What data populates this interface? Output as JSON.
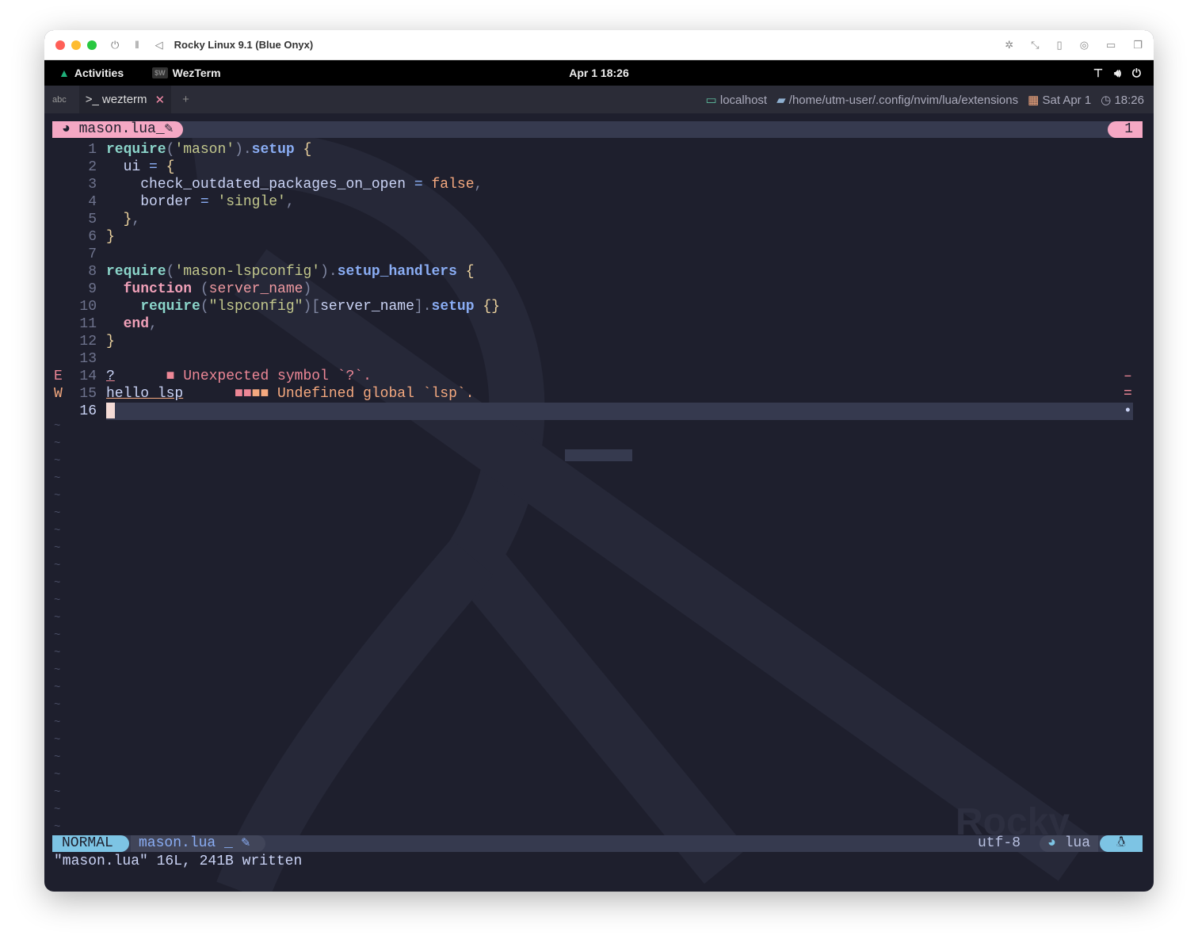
{
  "titlebar": {
    "title": "Rocky Linux 9.1 (Blue Onyx)",
    "icons": [
      "power-icon",
      "pause-icon",
      "back-icon",
      "capture-cursor-icon",
      "resize-icon",
      "usb-icon",
      "cd-icon",
      "shared-folder-icon",
      "windows-icon"
    ]
  },
  "gnome": {
    "activities": "Activities",
    "app": "WezTerm",
    "app_icon": "$W",
    "clock": "Apr 1  18:26"
  },
  "tabbar": {
    "abc": "abc",
    "tab_label": "wezterm",
    "tab_prompt": ">_",
    "host": "localhost",
    "path": "/home/utm-user/.config/nvim/lua/extensions",
    "date": "Sat Apr 1",
    "time": "18:26"
  },
  "tabline": {
    "buffer": "mason.lua_",
    "buffer_number": "1"
  },
  "lines": [
    {
      "n": "1",
      "t": [
        [
          "kw",
          "require"
        ],
        [
          "pun",
          "("
        ],
        [
          "str",
          "'mason'"
        ],
        [
          "pun",
          ")."
        ],
        [
          "fn",
          "setup"
        ],
        [
          "",
          ""
        ],
        [
          "br",
          " {"
        ]
      ]
    },
    {
      "n": "2",
      "t": [
        [
          "",
          "  ui "
        ],
        [
          "op",
          "="
        ],
        [
          "br",
          " {"
        ]
      ]
    },
    {
      "n": "3",
      "t": [
        [
          "",
          "    check_outdated_packages_on_open "
        ],
        [
          "op",
          "="
        ],
        [
          "bool",
          " false"
        ],
        [
          "pun",
          ","
        ]
      ]
    },
    {
      "n": "4",
      "t": [
        [
          "",
          "    border "
        ],
        [
          "op",
          "="
        ],
        [
          "str",
          " 'single'"
        ],
        [
          "pun",
          ","
        ]
      ]
    },
    {
      "n": "5",
      "t": [
        [
          "br",
          "  }"
        ],
        [
          "pun",
          ","
        ]
      ]
    },
    {
      "n": "6",
      "t": [
        [
          "br",
          "}"
        ]
      ]
    },
    {
      "n": "7",
      "t": []
    },
    {
      "n": "8",
      "t": [
        [
          "kw",
          "require"
        ],
        [
          "pun",
          "("
        ],
        [
          "str",
          "'mason-lspconfig'"
        ],
        [
          "pun",
          ")."
        ],
        [
          "fn",
          "setup_handlers"
        ],
        [
          "br",
          " {"
        ]
      ]
    },
    {
      "n": "9",
      "t": [
        [
          "key",
          "  function"
        ],
        [
          "pun",
          " ("
        ],
        [
          "par",
          "server_name"
        ],
        [
          "pun",
          ")"
        ]
      ]
    },
    {
      "n": "10",
      "t": [
        [
          "kw",
          "    require"
        ],
        [
          "pun",
          "("
        ],
        [
          "str",
          "\"lspconfig\""
        ],
        [
          "pun",
          ")["
        ],
        [
          "",
          "server_name"
        ],
        [
          "pun",
          "]."
        ],
        [
          "fn",
          "setup"
        ],
        [
          "br",
          " {}"
        ]
      ]
    },
    {
      "n": "11",
      "t": [
        [
          "key",
          "  end"
        ],
        [
          "pun",
          ","
        ]
      ]
    },
    {
      "n": "12",
      "t": [
        [
          "br",
          "}"
        ]
      ]
    },
    {
      "n": "13",
      "t": []
    },
    {
      "n": "14",
      "sign": "E",
      "t": [
        [
          "",
          "?"
        ],
        [
          "err",
          "      ■ Unexpected symbol `?`."
        ]
      ]
    },
    {
      "n": "15",
      "sign": "W",
      "t": [
        [
          "",
          "hello lsp"
        ],
        [
          "err",
          "      ■■"
        ],
        [
          "warn",
          "■■ Undefined global `lsp`."
        ]
      ]
    },
    {
      "n": "16",
      "t": []
    }
  ],
  "statusline": {
    "mode": "NORMAL",
    "file": "mason.lua _",
    "encoding": "utf-8",
    "filetype": "lua"
  },
  "message": "\"mason.lua\" 16L, 241B written",
  "colors": {
    "accent_pink": "#f5a8c4",
    "mode_blue": "#7dc4e4",
    "error": "#ed8796",
    "warning": "#f5a97f"
  }
}
